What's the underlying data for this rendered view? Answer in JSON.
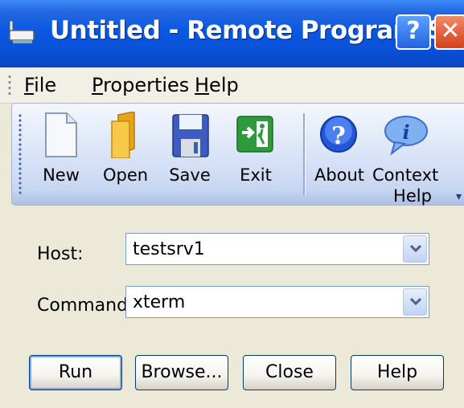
{
  "window": {
    "title": "Untitled - Remote Program Starter",
    "help_button": "?",
    "close_button": "✕"
  },
  "menu": [
    {
      "label": "File",
      "mnemonic": "F",
      "rest": "ile"
    },
    {
      "label": "Properties",
      "mnemonic": "P",
      "rest": "roperties"
    },
    {
      "label": "Help",
      "mnemonic": "H",
      "rest": "elp"
    }
  ],
  "toolbar": {
    "new": "New",
    "open": "Open",
    "save": "Save",
    "exit": "Exit",
    "about": "About",
    "context_help_line1": "Context",
    "context_help_line2": "Help"
  },
  "form": {
    "host_label": "Host:",
    "host_value": "testsrv1",
    "command_label": "Command:",
    "command_value": "xterm"
  },
  "buttons": {
    "run": "Run",
    "browse": "Browse...",
    "close": "Close",
    "help": "Help"
  },
  "colors": {
    "titlebar": "#0a58e3",
    "toolbar": "#dfe8f8",
    "window_bg": "#ece9d8"
  }
}
